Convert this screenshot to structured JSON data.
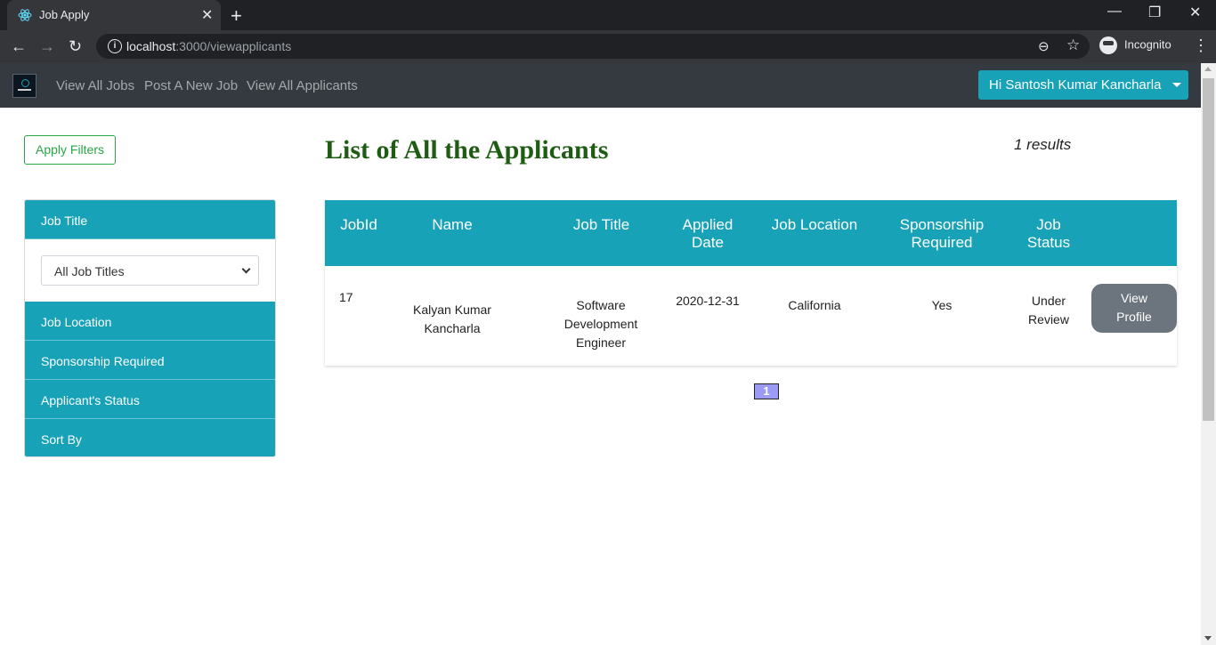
{
  "browser": {
    "tab_title": "Job Apply",
    "tab_close": "✕",
    "new_tab": "+",
    "url_host": "localhost",
    "url_path": ":3000/viewapplicants",
    "incognito_label": "Incognito",
    "window_controls": {
      "minimize": "—",
      "restore": "❐",
      "close": "✕"
    },
    "nav": {
      "back": "←",
      "forward": "→",
      "reload": "↻"
    },
    "zoom_icon": "⊖",
    "star_icon": "☆",
    "menu_icon": "⋮"
  },
  "navbar": {
    "links": [
      "View All Jobs",
      "Post A New Job",
      "View All Applicants"
    ],
    "user_button": "Hi Santosh Kumar Kancharla"
  },
  "sidebar": {
    "apply_filters": "Apply Filters",
    "job_title_header": "Job Title",
    "job_title_select": "All Job Titles",
    "sections": [
      "Job Location",
      "Sponsorship Required",
      "Applicant's Status",
      "Sort By"
    ]
  },
  "main": {
    "title": "List of All the Applicants",
    "results": "1 results",
    "columns": {
      "jobid": "JobId",
      "name": "Name",
      "job_title": "Job Title",
      "applied_date_1": "Applied",
      "applied_date_2": "Date",
      "job_location": "Job Location",
      "sponsorship_1": "Sponsorship",
      "sponsorship_2": "Required",
      "status_1": "Job",
      "status_2": "Status"
    },
    "rows": [
      {
        "jobid": "17",
        "name_1": "Kalyan Kumar",
        "name_2": "Kancharla",
        "job_title_1": "Software",
        "job_title_2": "Development",
        "job_title_3": "Engineer",
        "applied_date": "2020-12-31",
        "job_location": "California",
        "sponsorship": "Yes",
        "status_1": "Under",
        "status_2": "Review",
        "action_1": "View",
        "action_2": "Profile"
      }
    ],
    "pagination": [
      "1"
    ]
  }
}
